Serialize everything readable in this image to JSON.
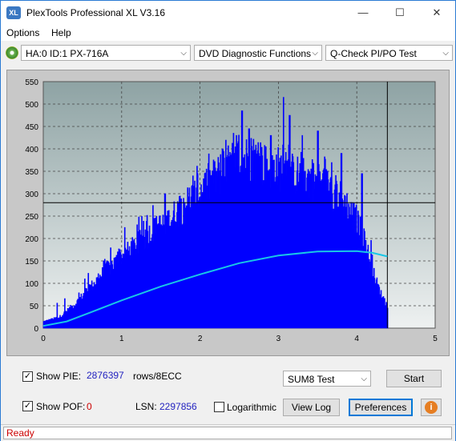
{
  "window": {
    "title": "PlexTools Professional XL V3.16",
    "app_icon_text": "XL",
    "controls": {
      "minimize": "—",
      "maximize": "☐",
      "close": "✕"
    }
  },
  "menu": {
    "items": [
      "Options",
      "Help"
    ]
  },
  "toolbar": {
    "drive": "HA:0 ID:1  PX-716A",
    "function": "DVD Diagnostic Functions",
    "test": "Q-Check PI/PO Test"
  },
  "chart_data": {
    "type": "bar",
    "title": "",
    "xlabel": "",
    "ylabel": "",
    "xlim": [
      0,
      5
    ],
    "ylim": [
      0,
      550
    ],
    "x_ticks": [
      "0",
      "1",
      "2",
      "3",
      "4",
      "5"
    ],
    "y_ticks": [
      "0",
      "50",
      "100",
      "150",
      "200",
      "250",
      "300",
      "350",
      "400",
      "450",
      "500",
      "550"
    ],
    "grid": true,
    "threshold_y": 280,
    "end_marker_x": 4.39,
    "series": [
      {
        "color": "#0000ff",
        "profile": {
          "x": [
            0.0,
            0.2,
            0.4,
            0.6,
            0.8,
            1.0,
            1.2,
            1.4,
            1.6,
            1.8,
            2.0,
            2.2,
            2.4,
            2.6,
            2.8,
            3.0,
            3.2,
            3.4,
            3.6,
            3.8,
            4.0,
            4.1,
            4.2,
            4.3,
            4.39
          ],
          "y": [
            15,
            25,
            55,
            95,
            135,
            165,
            195,
            225,
            250,
            285,
            320,
            350,
            380,
            395,
            380,
            370,
            355,
            345,
            330,
            300,
            250,
            200,
            130,
            80,
            50
          ]
        },
        "peak": {
          "x": [
            1.55,
            2.1,
            2.46,
            2.53,
            2.62,
            2.9,
            3.06,
            3.14,
            3.3,
            3.5,
            3.8,
            4.06
          ],
          "y": [
            300,
            355,
            430,
            485,
            445,
            430,
            515,
            475,
            430,
            440,
            390,
            345
          ]
        }
      },
      {
        "color": "#19c6e6",
        "x": [
          0.0,
          0.3,
          0.6,
          1.0,
          1.5,
          2.0,
          2.5,
          3.0,
          3.5,
          4.0,
          4.2,
          4.39
        ],
        "y": [
          5,
          15,
          35,
          62,
          93,
          120,
          145,
          162,
          171,
          172,
          168,
          160
        ]
      }
    ]
  },
  "controls": {
    "show_pie_label": "Show PIE:",
    "show_pie_checked": "✓",
    "pie_value": "2876397",
    "rows_label": "rows/8ECC",
    "show_pof_label": "Show POF:",
    "show_pof_checked": "✓",
    "pof_value": "0",
    "lsn_label": "LSN:",
    "lsn_value": "2297856",
    "log_label": "Logarithmic",
    "test_select": "SUM8 Test",
    "start": "Start",
    "view_log": "View Log",
    "preferences": "Preferences",
    "info_icon": "i"
  },
  "status": {
    "text": "Ready"
  }
}
